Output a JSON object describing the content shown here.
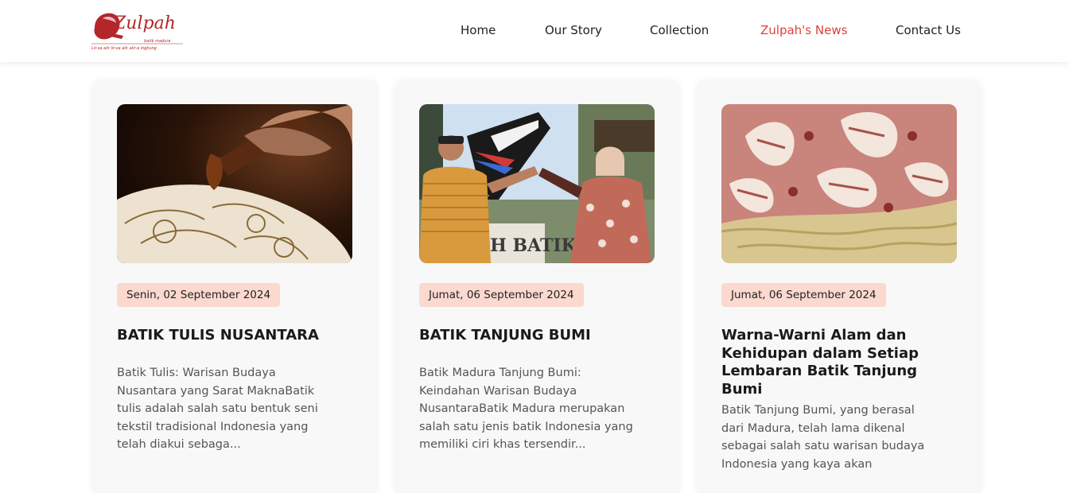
{
  "header": {
    "logo": {
      "name": "Zulpah",
      "sub": "batik madura",
      "tagline": "Lir-sa alir lir-sa alir alir-a ingkung"
    },
    "nav": [
      {
        "label": "Home"
      },
      {
        "label": "Our Story"
      },
      {
        "label": "Collection"
      },
      {
        "label": "Zulpah's News",
        "active": true
      },
      {
        "label": "Contact Us"
      }
    ]
  },
  "cards": [
    {
      "date": "Senin, 02 September 2024",
      "title": "BATIK TULIS NUSANTARA",
      "excerpt": "Batik Tulis: Warisan Budaya Nusantara yang Sarat MaknaBatik tulis adalah salah satu bentuk seni tekstil tradisional Indonesia yang telah diakui sebaga...",
      "image": "batik-canting-photo"
    },
    {
      "date": "Jumat, 06 September 2024",
      "title": "BATIK TANJUNG BUMI",
      "excerpt": "Batik Madura Tanjung Bumi: Keindahan Warisan Budaya NusantaraBatik Madura merupakan salah satu jenis batik Indonesia yang memiliki ciri khas tersendir...",
      "image": "tanjung-bumi-people-photo",
      "image_sign": "AH BATIK"
    },
    {
      "date": "Jumat, 06 September 2024",
      "title": "Warna-Warni Alam dan Kehidupan dalam Setiap Lembaran Batik Tanjung Bumi",
      "excerpt": "Batik Tanjung Bumi, yang berasal dari Madura, telah lama dikenal sebagai salah satu warisan budaya Indonesia yang kaya akan",
      "image": "batik-fabric-photo"
    }
  ],
  "colors": {
    "accent": "#e0403a",
    "badge": "#fbd9cf",
    "brand": "#b3262a"
  }
}
